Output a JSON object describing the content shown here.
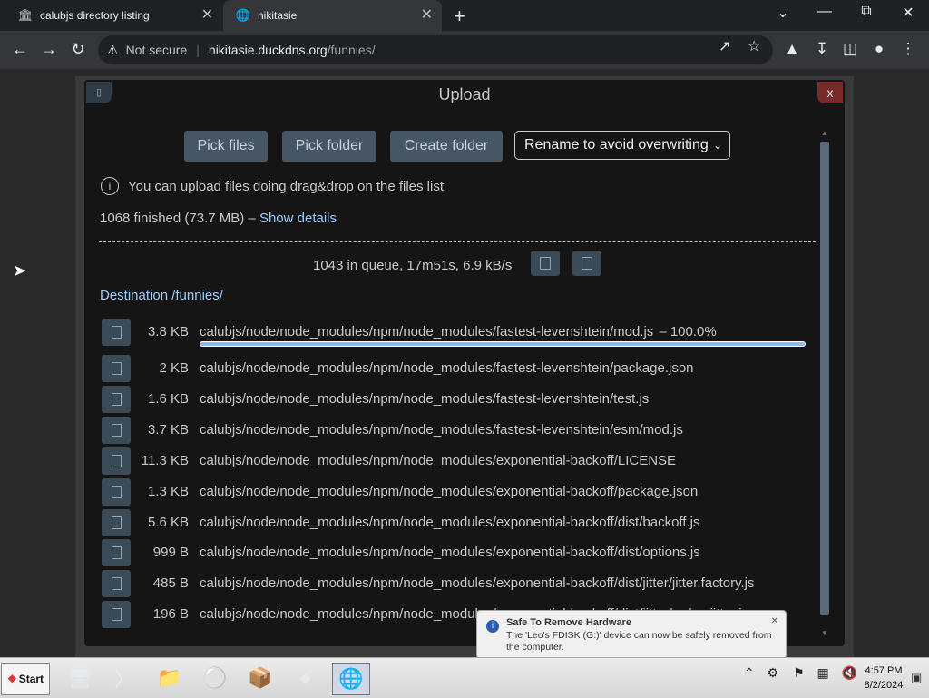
{
  "tabs": [
    {
      "title": "calubjs directory listing",
      "icon": "bank-icon"
    },
    {
      "title": "nikitasie",
      "icon": "globe-icon"
    }
  ],
  "omnibox": {
    "security": "Not secure",
    "host": "nikitasie.duckdns.org",
    "path": "/funnies/"
  },
  "modal": {
    "title": "Upload",
    "close": "x",
    "buttons": {
      "pick_files": "Pick files",
      "pick_folder": "Pick folder",
      "create_folder": "Create folder"
    },
    "rename_option": "Rename to avoid overwriting",
    "tip": "You can upload files doing drag&drop on the files list",
    "finished_text": "1068 finished (73.7 MB) –",
    "show_details": "Show details",
    "queue_text": "1043 in queue, 17m51s, 6.9 kB/s",
    "destination": "Destination /funnies/"
  },
  "files": [
    {
      "size": "3.8 KB",
      "path": "calubjs/node/node_modules/npm/node_modules/fastest-levenshtein/mod.js",
      "percent": "– 100.0%",
      "progress": 1.0
    },
    {
      "size": "2 KB",
      "path": "calubjs/node/node_modules/npm/node_modules/fastest-levenshtein/package.json"
    },
    {
      "size": "1.6 KB",
      "path": "calubjs/node/node_modules/npm/node_modules/fastest-levenshtein/test.js"
    },
    {
      "size": "3.7 KB",
      "path": "calubjs/node/node_modules/npm/node_modules/fastest-levenshtein/esm/mod.js"
    },
    {
      "size": "11.3 KB",
      "path": "calubjs/node/node_modules/npm/node_modules/exponential-backoff/LICENSE"
    },
    {
      "size": "1.3 KB",
      "path": "calubjs/node/node_modules/npm/node_modules/exponential-backoff/package.json"
    },
    {
      "size": "5.6 KB",
      "path": "calubjs/node/node_modules/npm/node_modules/exponential-backoff/dist/backoff.js"
    },
    {
      "size": "999 B",
      "path": "calubjs/node/node_modules/npm/node_modules/exponential-backoff/dist/options.js"
    },
    {
      "size": "485 B",
      "path": "calubjs/node/node_modules/npm/node_modules/exponential-backoff/dist/jitter/jitter.factory.js"
    },
    {
      "size": "196 B",
      "path": "calubjs/node/node_modules/npm/node_modules/exponential-backoff/dist/jitter/no/no.jitter.js"
    }
  ],
  "notification": {
    "title": "Safe To Remove Hardware",
    "message": "The 'Leo's FDISK (G:)' device can now be safely removed from the computer."
  },
  "taskbar": {
    "start": "Start",
    "time": "4:57 PM",
    "date": "8/2/2024"
  }
}
